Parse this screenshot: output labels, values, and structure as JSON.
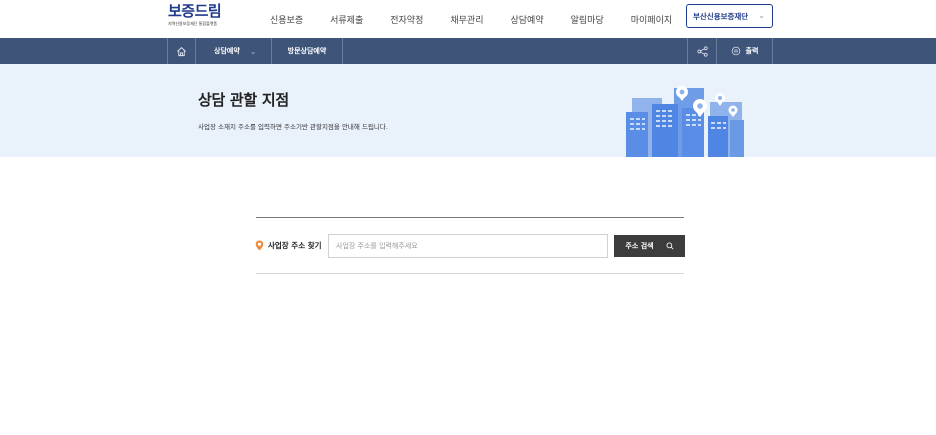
{
  "header": {
    "logo": {
      "title": "보증드림",
      "subtitle": "지역신용보증재단 통합플랫폼"
    },
    "nav": [
      "신용보증",
      "서류제출",
      "전자약정",
      "채무관리",
      "상담예약",
      "알림마당",
      "마이페이지"
    ],
    "org_select": {
      "value": "부산신용보증재단"
    }
  },
  "subbar": {
    "breadcrumb": [
      "상담예약",
      "방문상담예약"
    ],
    "print_label": "출력",
    "icons": [
      "home-icon",
      "chevron-down-icon",
      "share-icon",
      "print-icon"
    ]
  },
  "hero": {
    "title": "상담 관할 지점",
    "description": "사업장 소재지 주소를 입력하면 주소기반 관할지점을 안내해 드립니다."
  },
  "search": {
    "label": "사업장 주소 찾기",
    "placeholder": "사업장 주소를 입력해주세요",
    "value": "",
    "button_label": "주소 검색"
  },
  "colors": {
    "brand": "#1f3a8a",
    "subbar": "#3e5478",
    "hero_bg": "#e9f1fb",
    "button_dark": "#3c3c3c",
    "pin": "#f08a3c"
  }
}
